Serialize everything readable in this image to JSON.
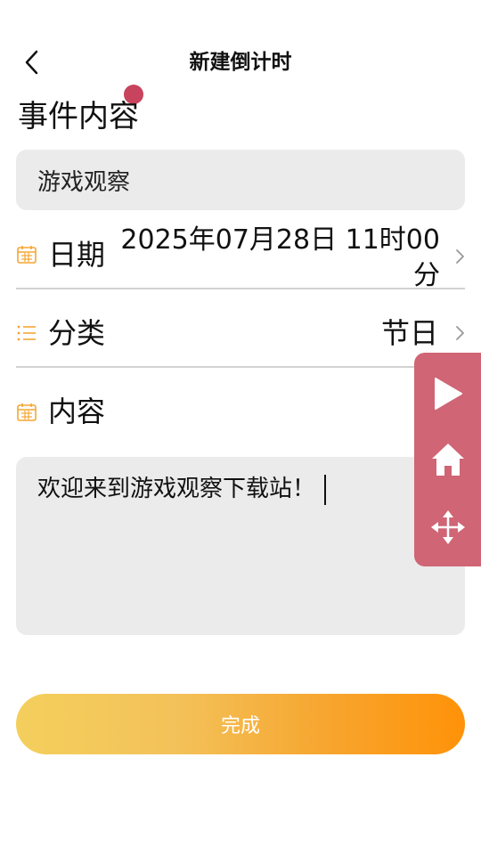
{
  "header": {
    "title": "新建倒计时",
    "back_icon": "chevron-left-icon"
  },
  "form": {
    "event_label": "事件内容",
    "event_title_value": "游戏观察",
    "date": {
      "icon": "calendar-icon",
      "label": "日期",
      "value": "2025年07月28日 11时00分"
    },
    "category": {
      "icon": "list-icon",
      "label": "分类",
      "value": "节日"
    },
    "content": {
      "icon": "calendar-icon",
      "label": "内容",
      "value": "欢迎来到游戏观察下载站！"
    }
  },
  "actions": {
    "finish_label": "完成"
  },
  "floating_panel": {
    "buttons": [
      "play-icon",
      "home-icon",
      "move-icon"
    ]
  },
  "colors": {
    "accent_orange": "#ff9208",
    "accent_yellow": "#f4cf5c",
    "field_bg": "#ebebeb",
    "panel_bg": "#d06575",
    "touch_dot": "#c8435d"
  }
}
